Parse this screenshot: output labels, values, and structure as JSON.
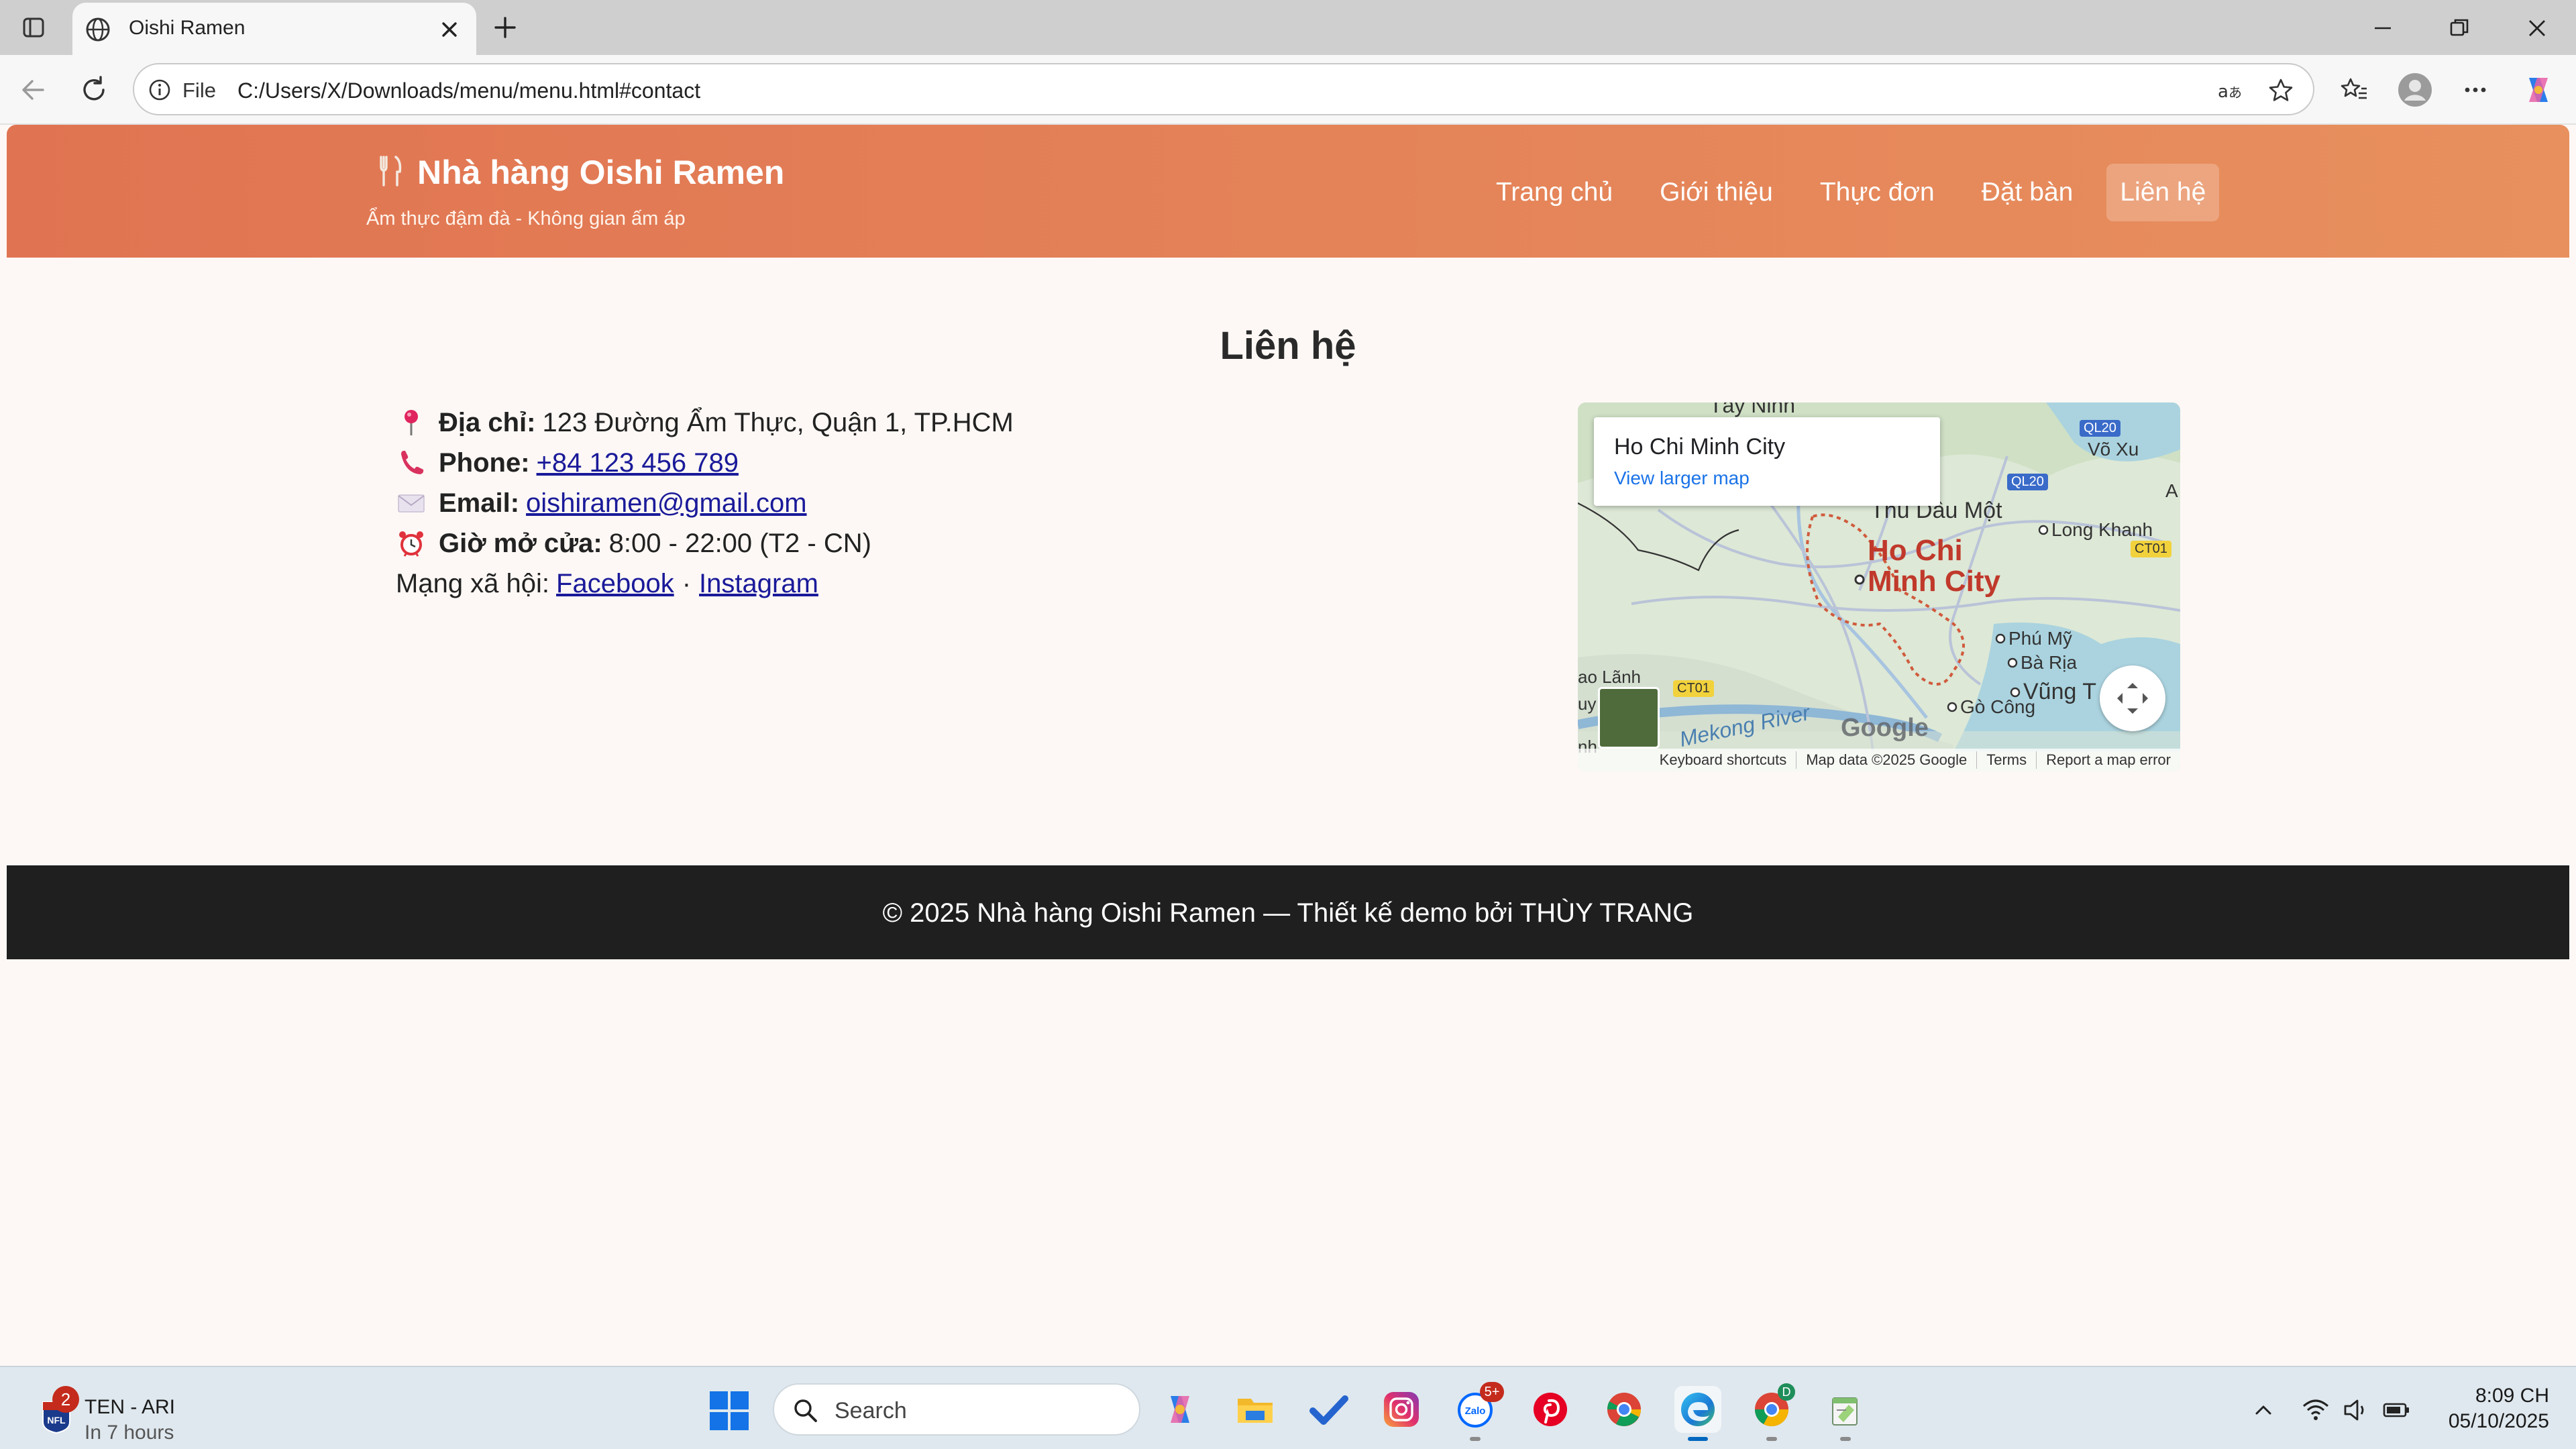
{
  "browser": {
    "tab_title": "Oishi Ramen",
    "scheme_label": "File",
    "url": "C:/Users/X/Downloads/menu/menu.html#contact"
  },
  "site": {
    "brand": "Nhà hàng Oishi Ramen",
    "tagline": "Ẩm thực đậm đà - Không gian ấm áp",
    "nav": [
      {
        "label": "Trang chủ"
      },
      {
        "label": "Giới thiệu"
      },
      {
        "label": "Thực đơn"
      },
      {
        "label": "Đặt bàn"
      },
      {
        "label": "Liên hệ",
        "active": true
      }
    ],
    "accent_color": "#e07452"
  },
  "contact": {
    "heading": "Liên hệ",
    "address_label": "Địa chỉ:",
    "address": "123 Đường Ẩm Thực, Quận 1, TP.HCM",
    "phone_label": "Phone:",
    "phone": "+84 123 456 789",
    "email_label": "Email:",
    "email": "oishiramen@gmail.com",
    "hours_label": "Giờ mở cửa:",
    "hours": "8:00 - 22:00 (T2 - CN)",
    "social_label": "Mạng xã hội:",
    "social_sep": "·",
    "facebook": "Facebook",
    "instagram": "Instagram"
  },
  "map": {
    "place": "Ho Chi Minh City",
    "view_larger": "View larger map",
    "city_label_1": "Ho Chi",
    "city_label_2": "Minh City",
    "labels": [
      "Tây Ninh",
      "Võ Xu",
      "Thủ Dầu Một",
      "Long Khanh",
      "Phú Mỹ",
      "Bà Rịa",
      "Vũng T",
      "Gò Công",
      "Mekong River",
      "ao Lãnh",
      "uy",
      "nh",
      "A"
    ],
    "shields": [
      "QL20",
      "QL20",
      "CT01",
      "CT01"
    ],
    "google": "Google",
    "footer": [
      "Keyboard shortcuts",
      "Map data ©2025 Google",
      "Terms",
      "Report a map error"
    ]
  },
  "footer": {
    "text": "© 2025 Nhà hàng Oishi Ramen — Thiết kế demo bởi THÙY TRANG"
  },
  "taskbar": {
    "widget_badge": "2",
    "widget_line1": "TEN - ARI",
    "widget_line2": "In 7 hours",
    "search_placeholder": "Search",
    "zalo_badge": "5+",
    "chrome_profile_badge": "D",
    "time": "8:09 CH",
    "date": "05/10/2025"
  }
}
